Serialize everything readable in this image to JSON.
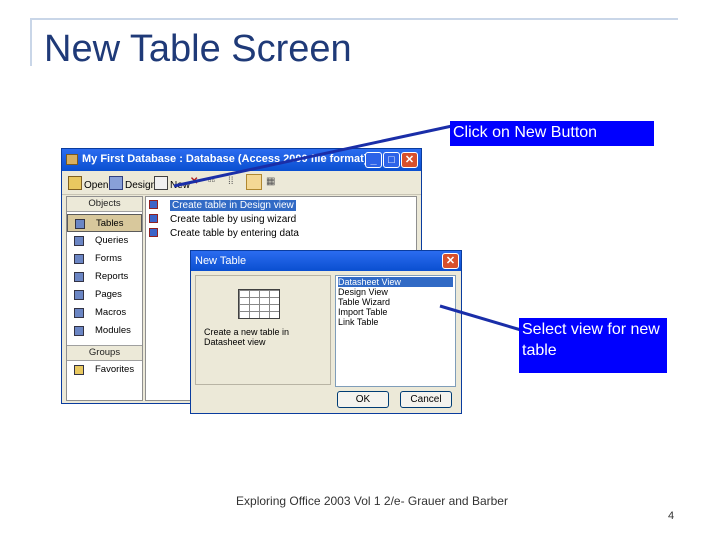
{
  "slide": {
    "title": "New Table Screen",
    "footer": "Exploring Office 2003 Vol 1 2/e- Grauer and Barber",
    "page_number": "4"
  },
  "callouts": {
    "new_button": "Click on New Button",
    "select_view": "Select view for new table"
  },
  "db_window": {
    "title": "My First Database : Database (Access 2000 file format)",
    "toolbar": {
      "open": "Open",
      "design": "Design",
      "new": "New"
    },
    "objects_header": "Objects",
    "objects": [
      {
        "label": "Tables",
        "selected": true
      },
      {
        "label": "Queries",
        "selected": false
      },
      {
        "label": "Forms",
        "selected": false
      },
      {
        "label": "Reports",
        "selected": false
      },
      {
        "label": "Pages",
        "selected": false
      },
      {
        "label": "Macros",
        "selected": false
      },
      {
        "label": "Modules",
        "selected": false
      }
    ],
    "groups_header": "Groups",
    "groups": [
      {
        "label": "Favorites"
      }
    ],
    "items": [
      "Create table in Design view",
      "Create table by using wizard",
      "Create table by entering data"
    ]
  },
  "new_table_dialog": {
    "title": "New Table",
    "description": "Create a new table in Datasheet view",
    "options": [
      "Datasheet View",
      "Design View",
      "Table Wizard",
      "Import Table",
      "Link Table"
    ],
    "selected_option": "Datasheet View",
    "ok_label": "OK",
    "cancel_label": "Cancel"
  },
  "colors": {
    "title": "#1f3a78",
    "callout_bg": "#0000ff",
    "arrow": "#1a2ea8",
    "selection": "#316ac5"
  }
}
